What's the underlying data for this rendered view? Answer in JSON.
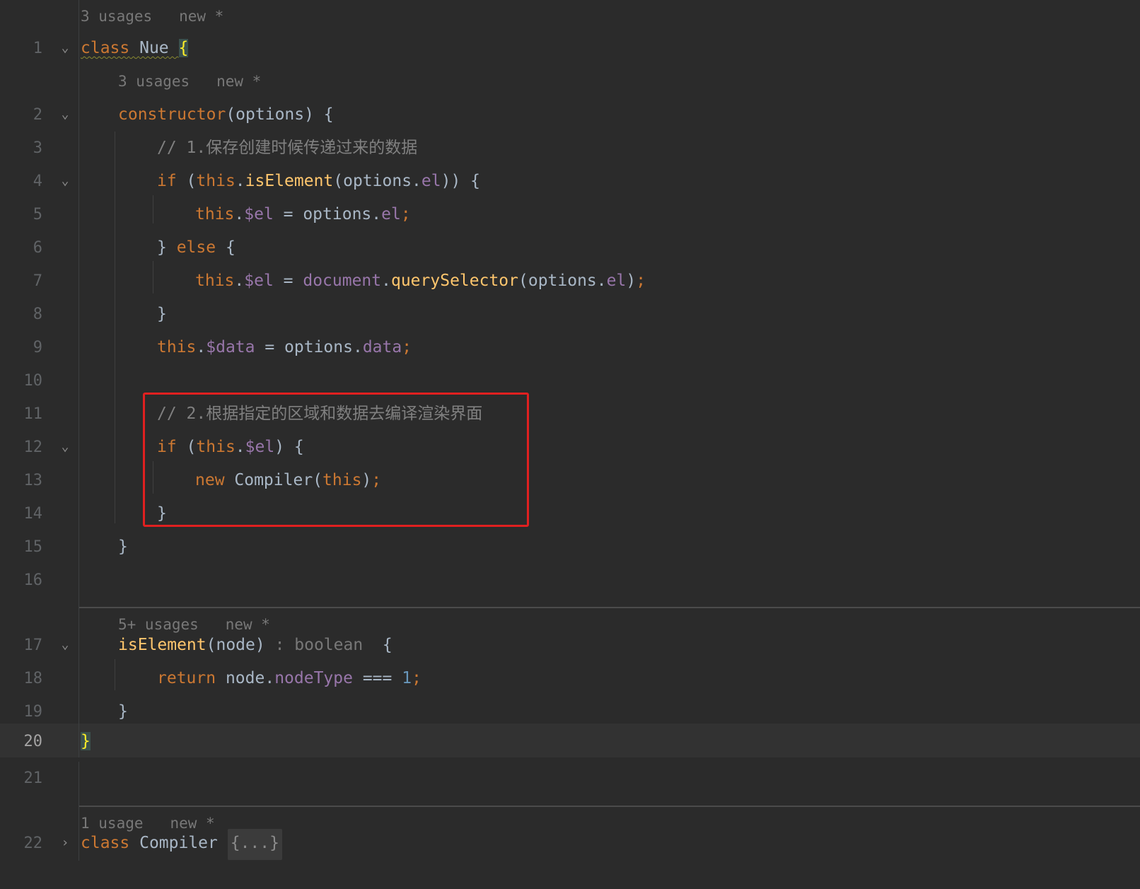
{
  "inlay_hints": {
    "h0": {
      "usages": "3 usages",
      "author": "new *"
    },
    "h2": {
      "usages": "3 usages",
      "author": "new *"
    },
    "h17": {
      "usages": "5+ usages",
      "author": "new *"
    },
    "h22": {
      "usages": "1 usage",
      "author": "new *"
    }
  },
  "line_numbers": [
    "1",
    "2",
    "3",
    "4",
    "5",
    "6",
    "7",
    "8",
    "9",
    "10",
    "11",
    "12",
    "13",
    "14",
    "15",
    "16",
    "17",
    "18",
    "19",
    "20",
    "21",
    "22"
  ],
  "current_line": "20",
  "code": {
    "l1": {
      "kw": "class",
      "name": "Nue",
      "brace": "{"
    },
    "l2": {
      "fn": "constructor",
      "rest": "(options) {"
    },
    "l3": {
      "comment": "// 1.保存创建时候传递过来的数据"
    },
    "l4": {
      "kw_if": "if",
      "p1": " (",
      "kw_this": "this",
      "dot": ".",
      "fn": "isElement",
      "p2": "(options.",
      "fld": "el",
      "p3": ")) {"
    },
    "l5": {
      "kw_this": "this",
      "dot": ".",
      "fld": "$el",
      "eq": " = options.",
      "fld2": "el",
      "semi": ";"
    },
    "l6": {
      "close": "} ",
      "kw_else": "else",
      "open": " {"
    },
    "l7": {
      "kw_this": "this",
      "dot": ".",
      "fld": "$el",
      "eq": " = ",
      "doc": "document",
      "dot2": ".",
      "fn": "querySelector",
      "p1": "(options.",
      "fld2": "el",
      "p2": ")",
      "semi": ";"
    },
    "l8": {
      "close": "}"
    },
    "l9": {
      "kw_this": "this",
      "dot": ".",
      "fld": "$data",
      "eq": " = options.",
      "fld2": "data",
      "semi": ";"
    },
    "l11": {
      "comment": "// 2.根据指定的区域和数据去编译渲染界面"
    },
    "l12": {
      "kw_if": "if",
      "p1": " (",
      "kw_this": "this",
      "dot": ".",
      "fld": "$el",
      "p2": ") {"
    },
    "l13": {
      "kw_new": "new",
      "cls": " Compiler(",
      "kw_this": "this",
      "p2": ")",
      "semi": ";"
    },
    "l14": {
      "close": "}"
    },
    "l15": {
      "close": "}"
    },
    "l17": {
      "fn": "isElement",
      "p1": "(node)",
      "type": " : boolean ",
      "p2": " {"
    },
    "l18": {
      "kw_return": "return",
      "p1": " node.",
      "fld": "nodeType",
      "op": " === ",
      "num": "1",
      "semi": ";"
    },
    "l19": {
      "close": "}"
    },
    "l20": {
      "brace": "}"
    },
    "l22": {
      "kw": "class",
      "name": " Compiler ",
      "folded": "{...}"
    }
  },
  "colors": {
    "background": "#2b2b2b",
    "keyword": "#cc7832",
    "function": "#ffc66d",
    "field": "#9876aa",
    "comment": "#808080",
    "number": "#6897bb",
    "highlight_box": "#e02020"
  },
  "icons": {
    "fold_expanded": "chevron-down-icon",
    "fold_collapsed": "chevron-right-icon"
  }
}
